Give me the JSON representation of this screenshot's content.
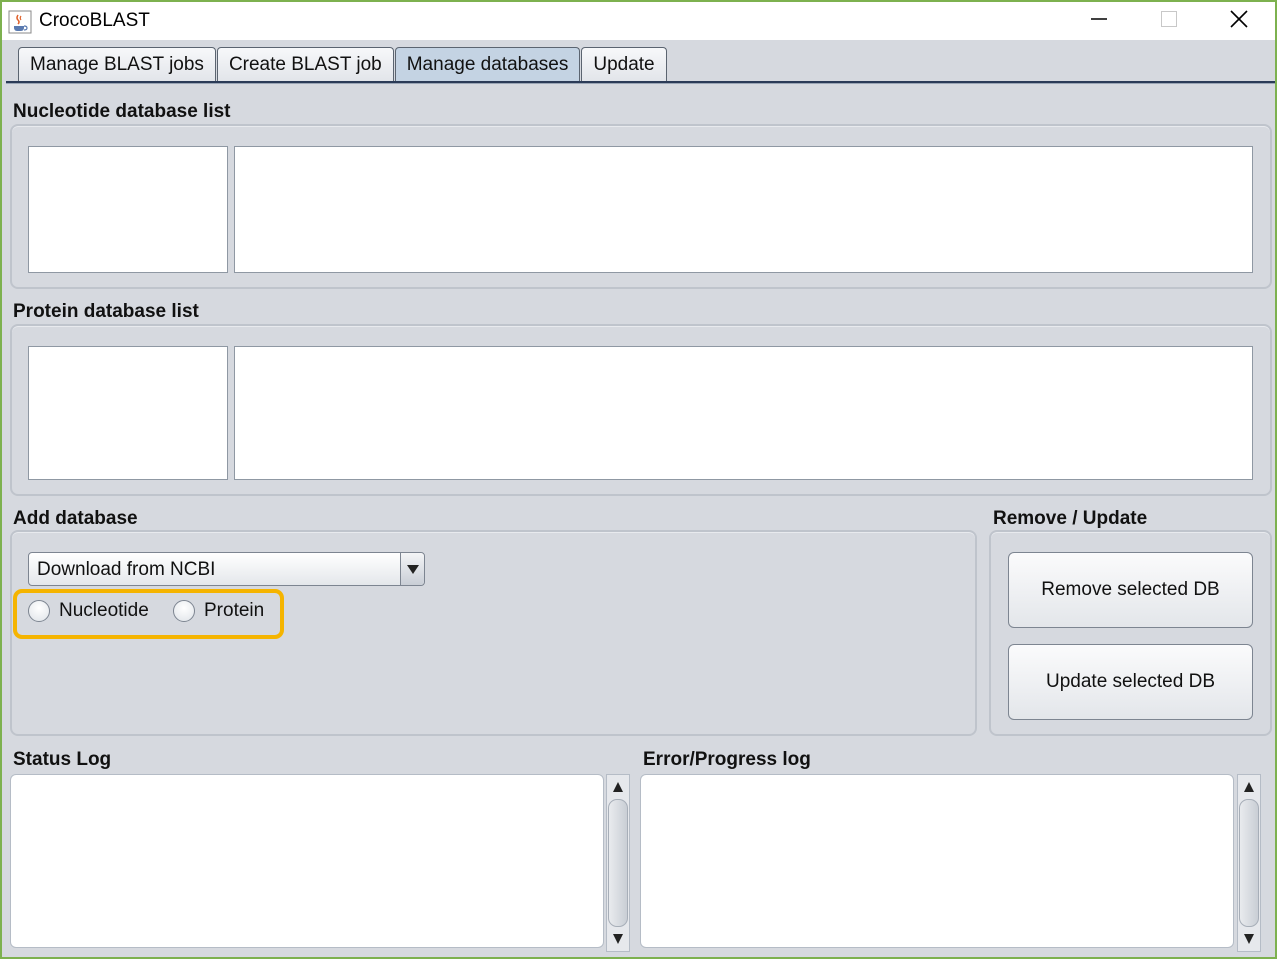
{
  "window": {
    "title": "CrocoBLAST",
    "icon": "java-cup-icon",
    "controls": [
      "minimize-icon",
      "maximize-icon",
      "close-icon"
    ]
  },
  "tabs": [
    {
      "label": "Manage BLAST jobs",
      "active": false
    },
    {
      "label": "Create BLAST job",
      "active": false
    },
    {
      "label": "Manage databases",
      "active": true
    },
    {
      "label": "Update",
      "active": false
    }
  ],
  "nucleotide": {
    "title": "Nucleotide database list"
  },
  "protein": {
    "title": "Protein database list"
  },
  "add_db": {
    "title": "Add database",
    "source_selected": "Download from NCBI",
    "radios": [
      {
        "label": "Nucleotide",
        "checked": false
      },
      {
        "label": "Protein",
        "checked": false
      }
    ],
    "highlight_color": "#f5b400"
  },
  "remove_update": {
    "title": "Remove / Update",
    "remove_label": "Remove selected DB",
    "update_label": "Update selected DB"
  },
  "logs": {
    "status_title": "Status Log",
    "error_title": "Error/Progress log"
  },
  "colors": {
    "window_border": "#7db14f",
    "panel_bg": "#d6d9df",
    "active_tab": "#c4d3e3"
  }
}
